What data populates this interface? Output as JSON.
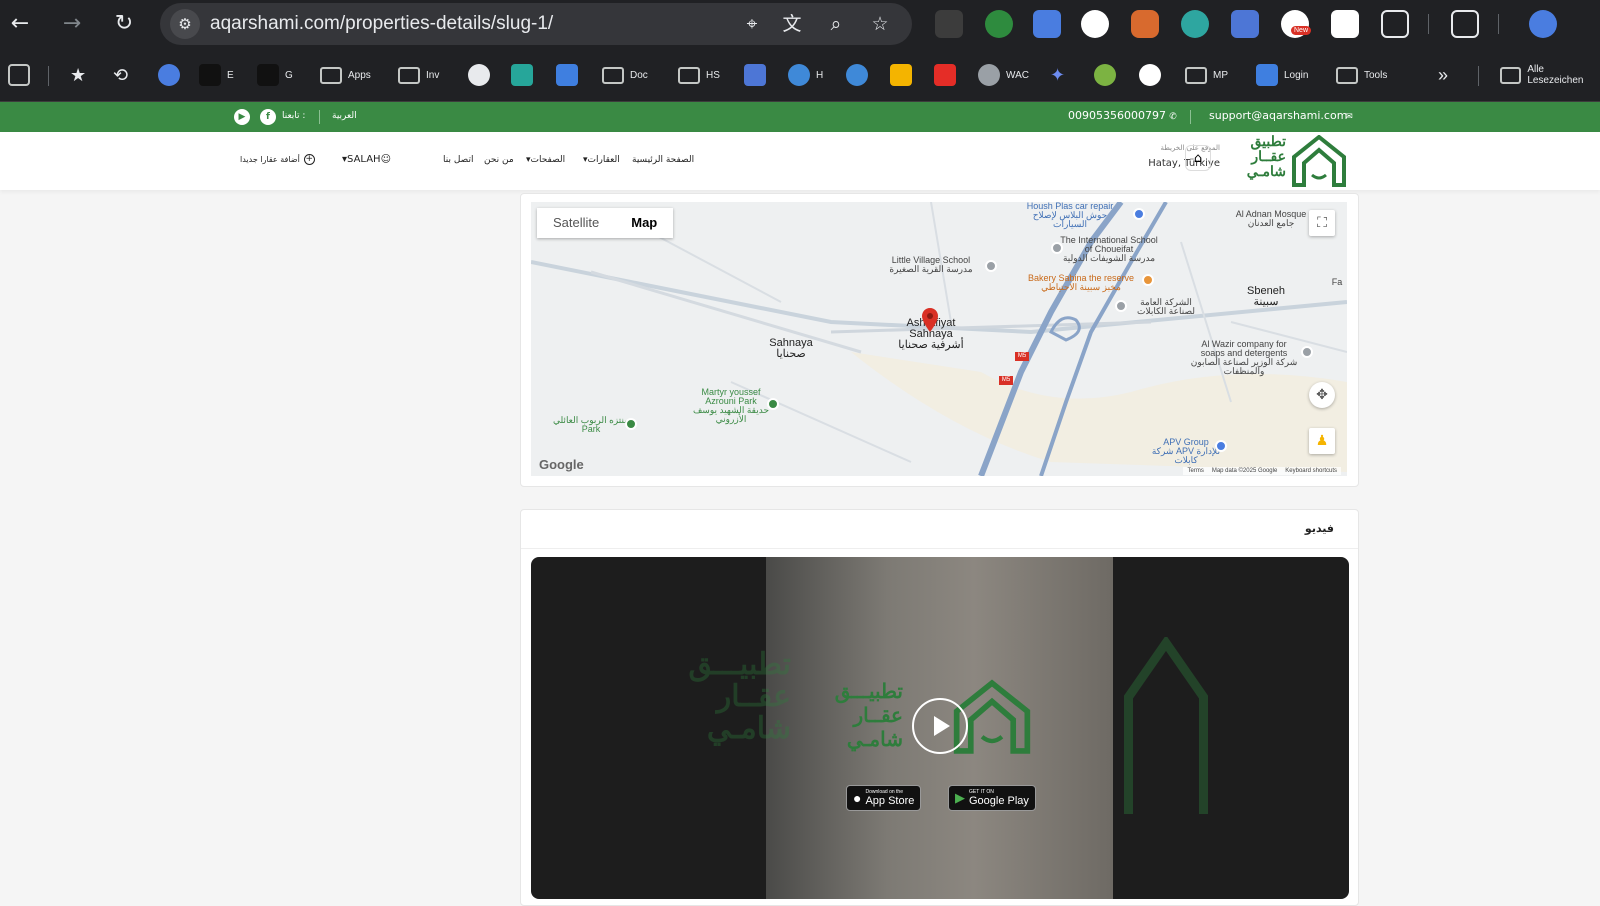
{
  "browser": {
    "url": "aqarshami.com/properties-details/slug-1/",
    "bookmarks": [
      {
        "label": "E"
      },
      {
        "label": "G"
      },
      {
        "label": "Apps"
      },
      {
        "label": "Inv"
      },
      {
        "label": "Doc"
      },
      {
        "label": "HS"
      },
      {
        "label": "H"
      },
      {
        "label": "WAC"
      },
      {
        "label": "MP"
      },
      {
        "label": "Login"
      },
      {
        "label": "Tools"
      },
      {
        "label": "Alle Lesezeichen"
      }
    ],
    "new_badge": "New"
  },
  "topbar": {
    "email": "support@aqarshami.com",
    "phone": "00905356000797",
    "language": "العربية",
    "follow_label": "تابعنا :"
  },
  "header": {
    "logo_lines": [
      "تطبيق",
      "عقــار",
      "شامـي"
    ],
    "location_label": "الموقع على الخريطة",
    "location_value": "Hatay, Türkiye",
    "menu": [
      "الصفحة الرئيسية",
      "العقارات",
      "الصفحات",
      "من نحن",
      "اتصل بنا"
    ],
    "user": "SALAH",
    "add_property": "أضافة عقارا جديدا"
  },
  "map": {
    "satellite": "Satellite",
    "map": "Map",
    "google": "Google",
    "footer": [
      "Keyboard shortcuts",
      "Map data ©2025 Google",
      "Terms"
    ],
    "labels": {
      "housh": "Housh Plas car repair",
      "housh_ar": "حوش البلاس لإصلاح السيارات",
      "adnan": "Al Adnan Mosque",
      "adnan_ar": "جامع العدنان",
      "intl": "The International School of Choueifat",
      "intl_ar": "مدرسة الشويفات الدولية",
      "little": "Little Village School",
      "little_ar": "مدرسة القرية الصغيرة",
      "bakery": "Bakery Sabina the reserve",
      "bakery_ar": "مخبز سبينة الاحتياطي",
      "cables": "الشركة العامة لصناعة الكابلات",
      "sbeneh": "Sbeneh",
      "sbeneh_ar": "سبينة",
      "sahnaya": "Sahnaya",
      "sahnaya_ar": "صحنايا",
      "ashrafiyat": "Ashrafiyat Sahnaya",
      "ashrafiyat_ar": "أشرفية صحنايا",
      "wazir": "Al Wazir company for soaps and detergents",
      "wazir_ar": "شركة الوزير لصناعة الصابون والمنظفات",
      "martyr": "Martyr youssef Azrouni Park",
      "martyr_ar": "حديقة الشهيد يوسف الأزروني",
      "raboub": "منتزه الربوب العائلي",
      "raboub_en": "Park",
      "apv": "APV Group",
      "apv_ar": "شركة APV للإدارة",
      "apv_ar2": "كابلات",
      "fa": "Fa",
      "m5": "M5"
    }
  },
  "video": {
    "title": "فيديو",
    "logo_lines": [
      "تطبيـــق",
      "عقــار",
      "شامـي"
    ],
    "app_store_small": "Download on the",
    "app_store": "App Store",
    "google_play_small": "GET IT ON",
    "google_play": "Google Play"
  },
  "colors": {
    "brand_green": "#3a8a44",
    "chrome_bg": "#202124"
  }
}
